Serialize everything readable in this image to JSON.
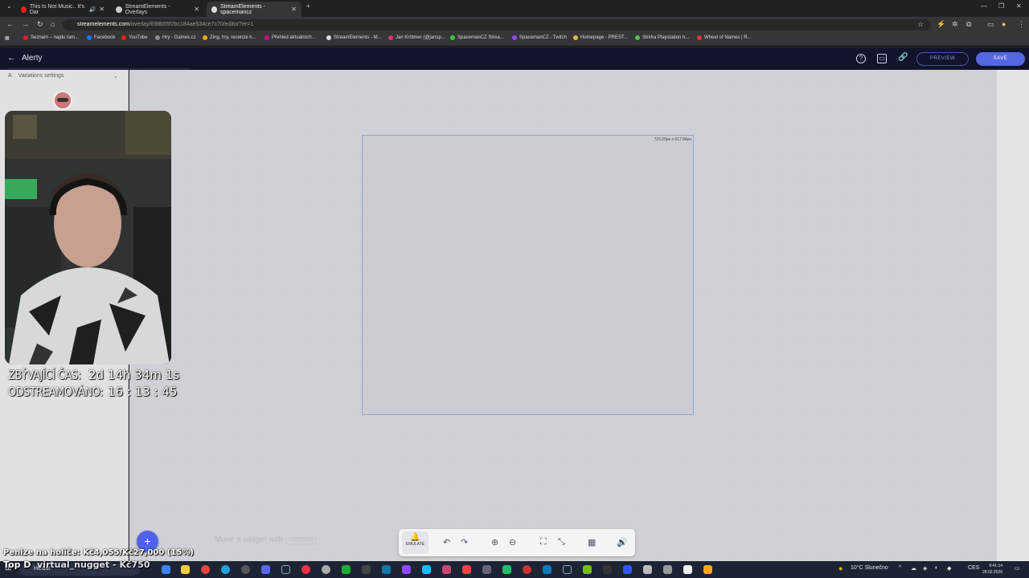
{
  "tabs": [
    {
      "label": "This Is Not Music.. It's Dar",
      "active": false
    },
    {
      "label": "StreamElements - Overlays",
      "active": false
    },
    {
      "label": "StreamElements - spacemancz",
      "active": true
    }
  ],
  "address": {
    "host": "streamelements.com",
    "path": "/overlay/698b55f2bc184ae534ce7c70/editor?er=1"
  },
  "bookmarks": [
    "Seznam – najdu tam...",
    "Facebook",
    "YouTube",
    "Hry - Games.cz",
    "Zing, hry, recenze h...",
    "Přehled aktuálních...",
    "StreamElements - M...",
    "Jan Krötmer (@jansp...",
    "SpacemanCZ Strea...",
    "SpacemanCZ - Twitch",
    "Homepage - PREST...",
    "Sbírka Playstation h...",
    "Wheel of Names | R..."
  ],
  "header": {
    "title": "Alerty",
    "preview": "PREVIEW",
    "save": "SAVE"
  },
  "sidebar": {
    "section": "Variations settings"
  },
  "overlay": {
    "remaining_label": "ZBÝVAJÍCÍ ČAS:",
    "remaining_value": "2d 14h 34m 1s",
    "streamed_label": "ODSTREAMOVÁNO:",
    "streamed_value": "16 : 13 : 45",
    "donations": "Penize na holiče: Kč4,055/Kč27,000 (15%)",
    "top": "Top D",
    "top_entry": "virtual_nugget - Kč750"
  },
  "canvas": {
    "dimensions": "723.20px x 617.84px"
  },
  "toolbar": {
    "emulate": "EMULATE"
  },
  "hint": {
    "text": "Move a widget with",
    "key": "ARROWS"
  },
  "taskbar": {
    "search": "Hledat",
    "weather": "10°C Slunečno",
    "lang": "CES",
    "time": "9:41:14",
    "date": "28.02.2026"
  },
  "colors": {
    "accent": "#5467e0",
    "header_bg": "#11142a",
    "canvas_bg": "#d0d1d6"
  }
}
